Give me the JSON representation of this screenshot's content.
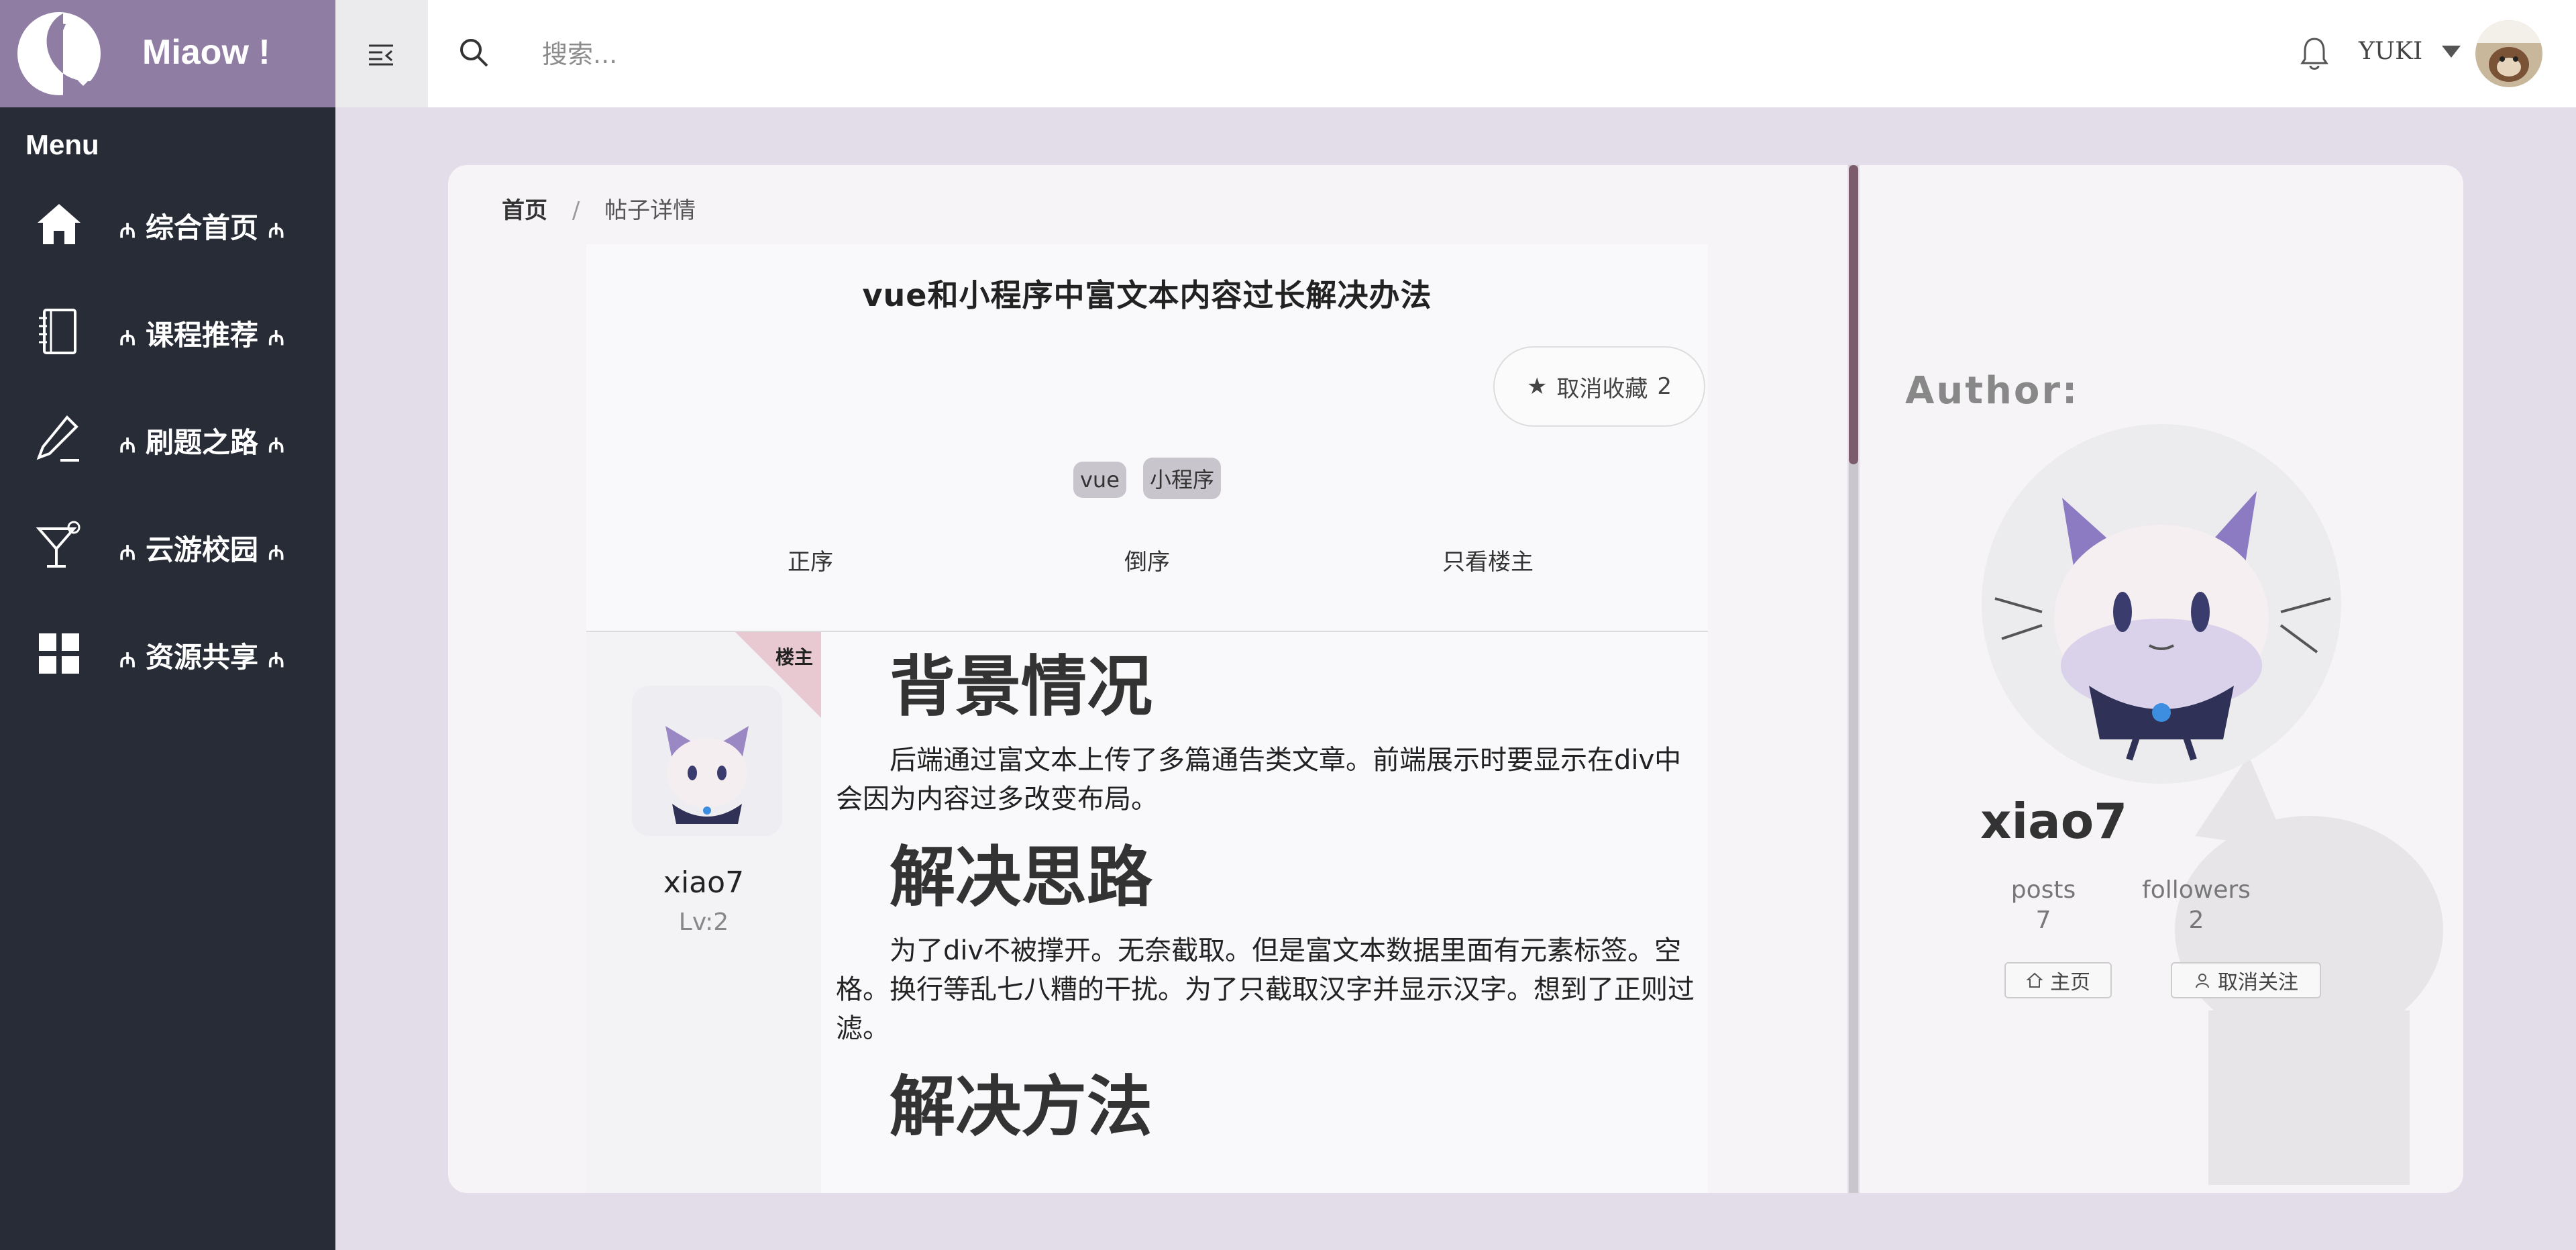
{
  "app": {
    "name": "Miaow !"
  },
  "sidebar": {
    "menu_title": "Menu",
    "items": [
      {
        "label": "综合首页",
        "icon": "home-icon"
      },
      {
        "label": "课程推荐",
        "icon": "notebook-icon"
      },
      {
        "label": "刷题之路",
        "icon": "pencil-icon"
      },
      {
        "label": "云游校园",
        "icon": "cocktail-icon"
      },
      {
        "label": "资源共享",
        "icon": "grid-icon"
      }
    ],
    "paw": "₼"
  },
  "header": {
    "search_placeholder": "搜索...",
    "username": "YUKI"
  },
  "breadcrumb": {
    "home": "首页",
    "separator": "/",
    "current": "帖子详情"
  },
  "post": {
    "title": "vue和小程序中富文本内容过长解决办法",
    "favorite_label": "取消收藏",
    "favorite_count": "2",
    "tags": [
      "vue",
      "小程序"
    ],
    "sort_options": [
      "正序",
      "倒序",
      "只看楼主"
    ],
    "owner_badge": "楼主",
    "poster_name": "xiao7",
    "poster_level": "Lv:2",
    "sections": [
      {
        "heading": "背景情况",
        "text": "后端通过富文本上传了多篇通告类文章。前端展示时要显示在div中会因为内容过多改变布局。"
      },
      {
        "heading": "解决思路",
        "text": "为了div不被撑开。无奈截取。但是富文本数据里面有元素标签。空格。换行等乱七八糟的干扰。为了只截取汉字并显示汉字。想到了正则过滤。"
      },
      {
        "heading": "解决方法",
        "text": ""
      }
    ]
  },
  "author": {
    "heading": "Author:",
    "name": "xiao7",
    "posts_label": "posts",
    "posts_value": "7",
    "followers_label": "followers",
    "followers_value": "2",
    "home_button": "主页",
    "unfollow_button": "取消关注"
  },
  "colors": {
    "sidebar_bg": "#272c36",
    "logo_bg": "#8f7da3",
    "page_bg": "#e3dde9",
    "scroll_thumb": "#7c5c6c"
  }
}
